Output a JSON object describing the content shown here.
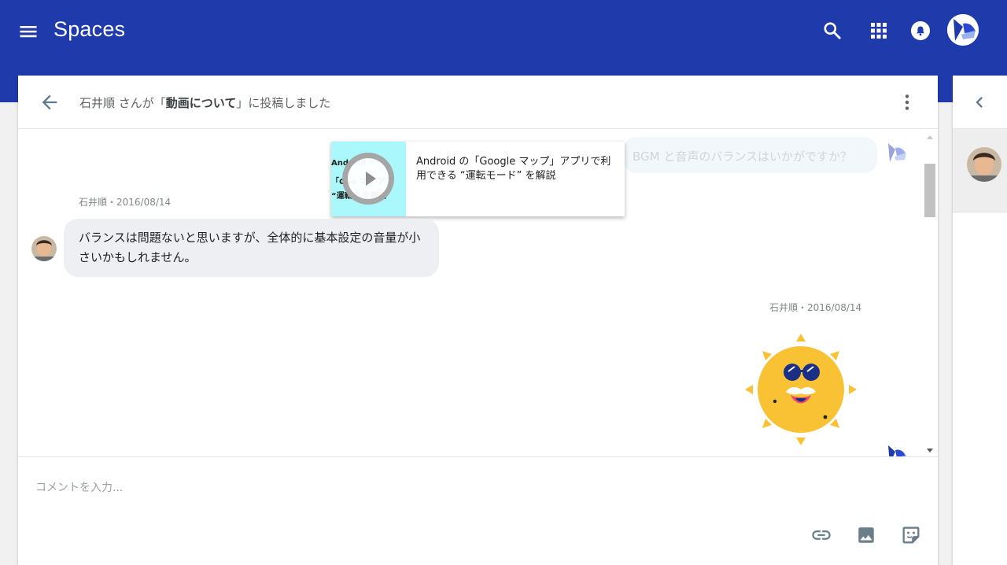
{
  "appbar": {
    "title": "Spaces",
    "icons": [
      "menu-icon",
      "search-icon",
      "apps-grid-icon",
      "notifications-icon",
      "account-avatar"
    ]
  },
  "header": {
    "prefix": "石井順 さんが「",
    "topic": "動画について",
    "suffix": "」に投稿しました"
  },
  "thread": {
    "faded_message": "BGM と音声のバランスはいかがですか？",
    "video_card": {
      "title": "Android の「Google マップ」アプリで利用できる “運転モード” を解説",
      "thumb_line1": "Android",
      "thumb_line2": "「Goo   マ  」アプ",
      "thumb_line3": "“運転モ    を解説"
    },
    "messages": [
      {
        "author_meta": "石井順・2016/08/14",
        "text": "バランスは問題ないと思いますが、全体的に基本設定の音量が小さいかもしれません。"
      },
      {
        "author_meta": "石井順・2016/08/14",
        "sticker": "sun-sunglasses-sticker"
      }
    ]
  },
  "composer": {
    "placeholder": "コメントを入力..."
  },
  "colors": {
    "appbar": "#1f3aab",
    "bubble": "#edeff2",
    "video_thumb": "#aaf8fb",
    "sun": "#f8c234"
  }
}
